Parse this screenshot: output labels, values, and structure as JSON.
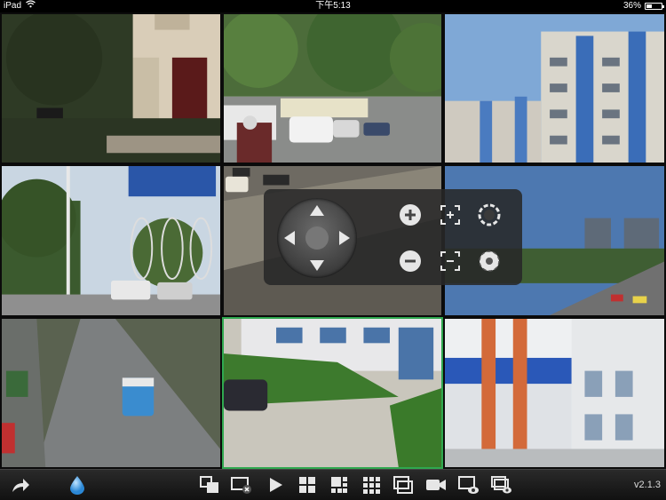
{
  "status_bar": {
    "device": "iPad",
    "time": "下午5:13",
    "battery": "36%",
    "battery_level": 0.36
  },
  "video_grid": {
    "selected_channel": 8,
    "channels": [
      {
        "scene": "house-entrance"
      },
      {
        "scene": "street-traffic"
      },
      {
        "scene": "apartment-buildings"
      },
      {
        "scene": "road-billboard"
      },
      {
        "scene": "highway-overpass"
      },
      {
        "scene": "city-highway"
      },
      {
        "scene": "highway-aerial"
      },
      {
        "scene": "building-lawn"
      },
      {
        "scene": "factory-gate"
      }
    ]
  },
  "ptz_panel": {
    "controls": [
      "pan-up",
      "pan-down",
      "pan-left",
      "pan-right",
      "zoom-in",
      "zoom-out",
      "focus-near",
      "focus-far",
      "iris-open",
      "iris-close"
    ]
  },
  "toolbar": {
    "buttons": [
      "back-icon",
      "ptz-icon",
      "close-channel-icon",
      "play-icon",
      "layout-4-icon",
      "layout-6-icon",
      "layout-9-icon",
      "layout-16-icon",
      "record-icon",
      "preview-icon",
      "playback-icon"
    ],
    "version": "v2.1.3"
  }
}
